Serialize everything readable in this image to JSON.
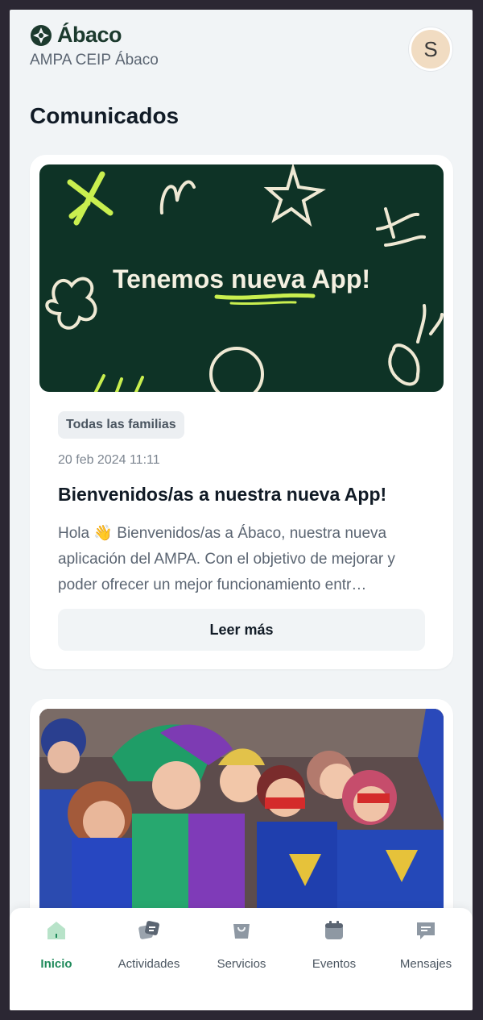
{
  "app": {
    "name": "Ábaco",
    "subtitle": "AMPA CEIP Ábaco",
    "avatar_initial": "S"
  },
  "section": {
    "title": "Comunicados"
  },
  "posts": [
    {
      "banner_text": "Tenemos nueva App!",
      "badge": "Todas las familias",
      "date": "20 feb 2024 11:11",
      "title": "Bienvenidos/as a nuestra nueva App!",
      "excerpt": "Hola 👋 Bienvenidos/as a Ábaco, nuestra nueva aplicación del AMPA. Con el objetivo de mejorar y poder ofrecer un mejor funcionamiento entr…",
      "cta": "Leer más"
    },
    {
      "image": "carnival-photo"
    }
  ],
  "tabs": [
    {
      "label": "Inicio",
      "icon": "home-icon",
      "active": true
    },
    {
      "label": "Actividades",
      "icon": "activities-icon",
      "active": false
    },
    {
      "label": "Servicios",
      "icon": "bag-icon",
      "active": false
    },
    {
      "label": "Eventos",
      "icon": "calendar-icon",
      "active": false
    },
    {
      "label": "Mensajes",
      "icon": "message-icon",
      "active": false
    }
  ],
  "colors": {
    "brand": "#1c3a2e",
    "accent": "#1f8a5b",
    "banner_bg": "#0e3326",
    "background": "#f1f4f6"
  }
}
